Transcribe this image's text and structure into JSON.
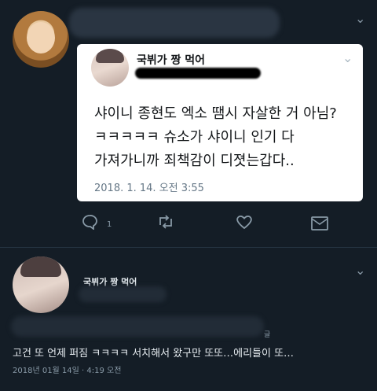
{
  "tweet_card": {
    "author_name": "국뷔가 짱 먹어",
    "text": "샤이니 종현도 엑소 땜시 자살한 거 아님?\nㅋㅋㅋㅋㅋ 슈소가 샤이니 인기 다\n가져가니까 죄책감이 디졋는갑다..",
    "timestamp": "2018. 1. 14. 오전 3:55"
  },
  "actions": {
    "reply_icon": "reply-icon",
    "reply_count": "1",
    "retweet_icon": "retweet-icon",
    "like_icon": "heart-icon",
    "dm_icon": "mail-icon"
  },
  "reply": {
    "author_name": "국뷔가 짱 먹어",
    "tag": "글",
    "text": "고건 또 언제 퍼짐 ㅋㅋㅋㅋ 서치해서 왔구만 또또…에리들이 또…",
    "timestamp": "2018년 01월 14일 · 4:19 오전"
  },
  "colors": {
    "background": "#141d26",
    "card": "#ffffff",
    "muted": "#8899a6"
  }
}
